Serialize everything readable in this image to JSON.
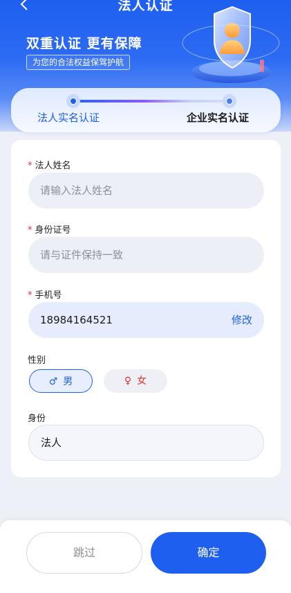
{
  "nav": {
    "title": "法人认证"
  },
  "banner": {
    "slogan": "双重认证 更有保障",
    "tag": "为您的合法权益保驾护航"
  },
  "steps": [
    {
      "label": "法人实名认证",
      "active": true
    },
    {
      "label": "企业实名认证",
      "active": false
    }
  ],
  "form": {
    "name": {
      "required_mark": "*",
      "label": "法人姓名",
      "placeholder": "请输入法人姓名"
    },
    "id_number": {
      "required_mark": "*",
      "label": "身份证号",
      "placeholder": "请与证件保持一致"
    },
    "phone": {
      "required_mark": "*",
      "label": "手机号",
      "value": "18984164521",
      "edit_label": "修改"
    },
    "gender": {
      "label": "性别",
      "options": [
        {
          "symbol": "♂",
          "label": "男",
          "selected": true
        },
        {
          "symbol": "♀",
          "label": "女",
          "selected": false
        }
      ]
    },
    "identity": {
      "label": "身份",
      "value": "法人"
    }
  },
  "actions": {
    "skip_label": "跳过",
    "confirm_label": "确定"
  },
  "colors": {
    "primary": "#1f5ff0",
    "required": "#e5302f",
    "female": "#e5302f"
  },
  "icons": {
    "back": "chevron-left-icon",
    "illustration": "shield-user-icon"
  }
}
